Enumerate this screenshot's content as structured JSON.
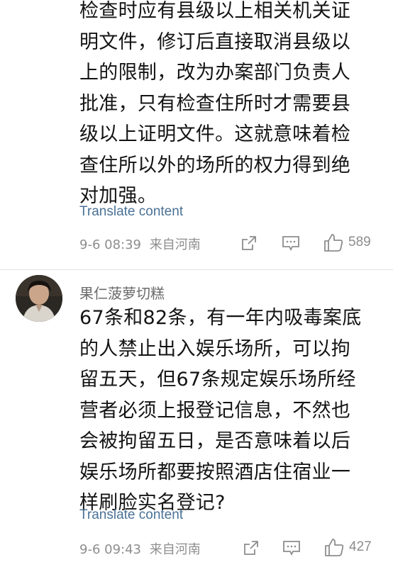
{
  "comments": [
    {
      "lines": [
        "检查时应有县级以上相关机关证",
        "明文件，修订后直接取消县级以",
        "上的限制，改为办案部门负责人",
        "批准，只有检查住所时才需要县",
        "级以上证明文件。这就意味着检",
        "查住所以外的场所的权力得到绝",
        "对加强。"
      ],
      "translate_label": "Translate content",
      "time": "9-6 08:39",
      "location": "来自河南",
      "likes": "589"
    },
    {
      "username": "果仁菠萝切糕",
      "lines": [
        "67条和82条，有一年内吸毒案底",
        "的人禁止出入娱乐场所，可以拘",
        "留五天，但67条规定娱乐场所经",
        "营者必须上报登记信息，不然也",
        "会被拘留五日，是否意味着以后",
        "娱乐场所都要按照酒店住宿业一",
        "样刷脸实名登记?"
      ],
      "translate_label": "Translate content",
      "time": "9-6 09:43",
      "location": "来自河南",
      "likes": "427"
    }
  ],
  "icons": [
    "share-icon",
    "reply-icon",
    "thumbs-up-icon"
  ],
  "colors": {
    "link": "#4a7196",
    "meta": "#8d8d8d",
    "text": "#141414"
  }
}
